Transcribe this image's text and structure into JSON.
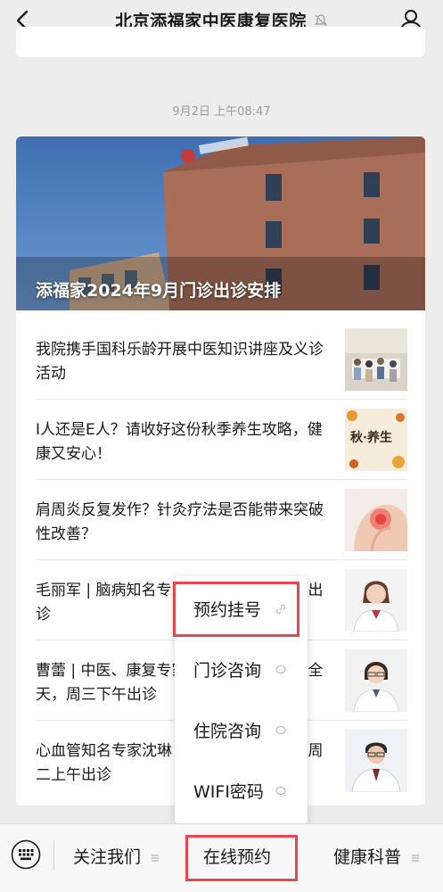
{
  "header": {
    "title": "北京添福家中医康复医院"
  },
  "timestamp": "9月2日 上午08:47",
  "hero": {
    "title": "添福家2024年9月门诊出诊安排"
  },
  "articles": [
    {
      "title": "我院携手国科乐龄开展中医知识讲座及义诊活动"
    },
    {
      "title": "I人还是E人？请收好这份秋季养生攻略，健康又安心！",
      "thumb_text": "秋·养生"
    },
    {
      "title": "肩周炎反复发作？针灸疗法是否能带来突破性改善？"
    },
    {
      "title": "毛丽军 | 脑病知名专家，周二、周六上午出诊"
    },
    {
      "title": "曹蕾 | 中医、康复专家，周一下午、周四全天，周三下午出诊"
    },
    {
      "title": "心血管知名专家沈琳 | 周三全天、周四至周二上午出诊"
    }
  ],
  "popup_menu": {
    "items": [
      {
        "label": "预约挂号",
        "icon": "link-icon"
      },
      {
        "label": "门诊咨询",
        "icon": "chat-icon"
      },
      {
        "label": "住院咨询",
        "icon": "chat-icon"
      },
      {
        "label": "WIFI密码",
        "icon": "chat-icon"
      }
    ]
  },
  "bottom_menu": {
    "items": [
      {
        "label": "关注我们"
      },
      {
        "label": "在线预约"
      },
      {
        "label": "健康科普"
      }
    ]
  },
  "colors": {
    "highlight": "#e8454d",
    "background": "#ededed"
  }
}
